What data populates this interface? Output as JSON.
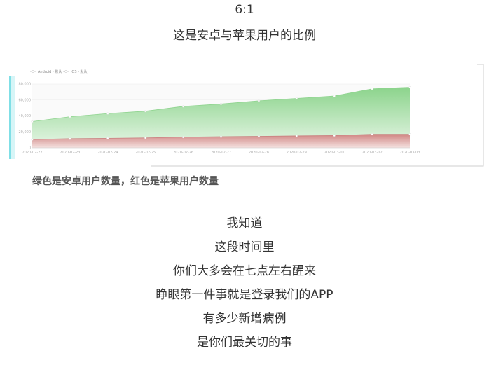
{
  "header": {
    "ratio": "6:1",
    "subtitle": "这是安卓与苹果用户的比例"
  },
  "chart_data": {
    "type": "area",
    "x": [
      "2020-02-22",
      "2020-02-23",
      "2020-02-24",
      "2020-02-25",
      "2020-02-26",
      "2020-02-27",
      "2020-02-28",
      "2020-02-29",
      "2020-03-01",
      "2020-03-02",
      "2020-03-03"
    ],
    "series": [
      {
        "name": "Android - 默认",
        "color": "#8fd48f",
        "values": [
          33000,
          39000,
          43000,
          46000,
          52000,
          55000,
          59000,
          62000,
          65000,
          74000,
          76000
        ]
      },
      {
        "name": "iOS - 默认",
        "color": "#d98a8a",
        "values": [
          10500,
          11500,
          12000,
          12500,
          13500,
          14000,
          14500,
          15000,
          15500,
          17000,
          17000
        ]
      }
    ],
    "yticks": [
      "0",
      "20,000",
      "40,000",
      "60,000",
      "80,000"
    ],
    "ylim": [
      0,
      80000
    ],
    "grid": true,
    "legend": "top-left"
  },
  "caption": "绿色是安卓用户数量，红色是苹果用户数量",
  "body_lines": [
    "我知道",
    "这段时间里",
    "你们大多会在七点左右醒来",
    "睁眼第一件事就是登录我们的APP",
    "有多少新增病例",
    "是你们最关切的事"
  ]
}
